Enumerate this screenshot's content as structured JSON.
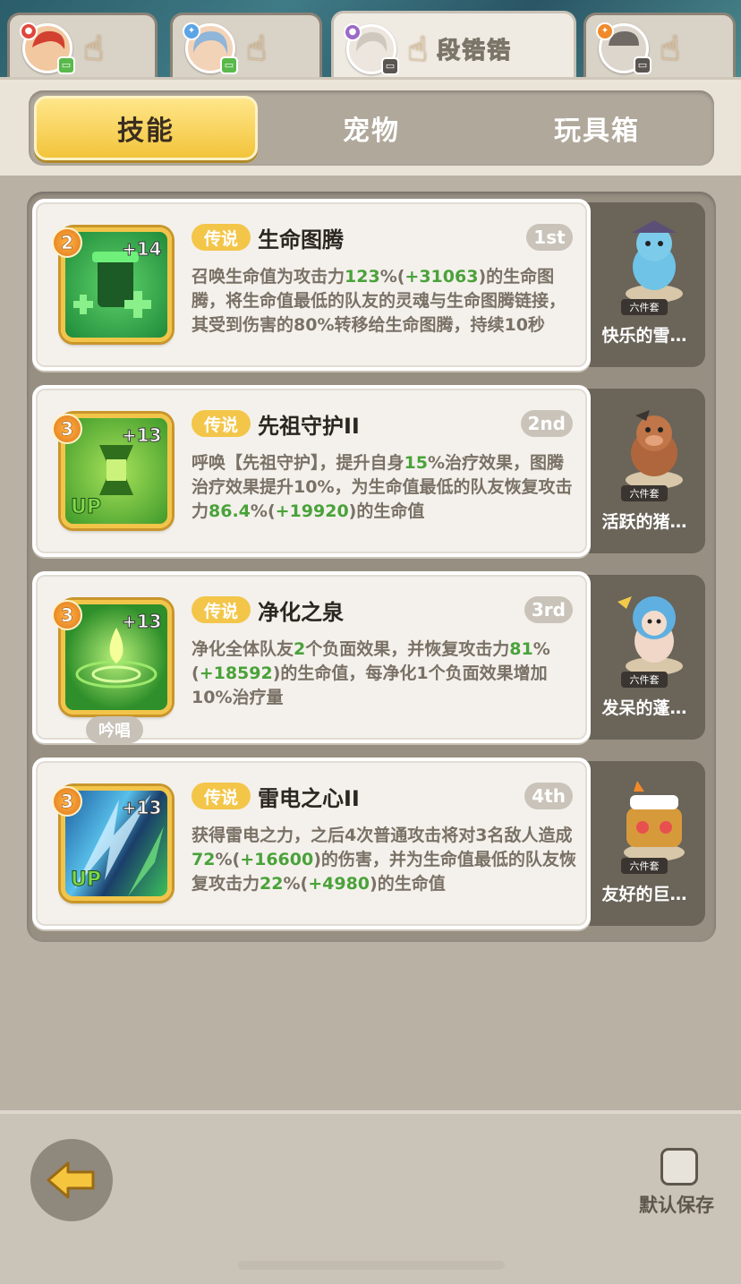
{
  "hero_tabs": [
    {
      "name": "",
      "badge_color": "#59b94a",
      "elem_color": "#e0473c",
      "hair_color": "#d2402f",
      "skin": "#f2c8a0"
    },
    {
      "name": "",
      "badge_color": "#59b94a",
      "elem_color": "#5ba4e6",
      "hair_color": "#8fb5d8",
      "skin": "#f3d3b8"
    },
    {
      "name": "段锆锆",
      "badge_color": "#5a5550",
      "elem_color": "#9b6ac6",
      "hair_color": "#d9d4cd",
      "skin": "#ece6de"
    },
    {
      "name": "",
      "badge_color": "#5a5550",
      "elem_color": "#f08a2a",
      "hair_color": "#6f6a63",
      "skin": "#ddd6cc"
    }
  ],
  "category_tabs": [
    {
      "label": "技能",
      "active": true
    },
    {
      "label": "宠物",
      "active": false
    },
    {
      "label": "玩具箱",
      "active": false
    }
  ],
  "skills": [
    {
      "level": "2",
      "plus": "+14",
      "rarity": "传说",
      "name": "生命图腾",
      "rank": "1st",
      "up": "",
      "chant": "",
      "icon_bg": "#1f8a3a",
      "icon_glyph": "✚",
      "desc": [
        {
          "t": "召唤生命值为攻击力"
        },
        {
          "t": "123",
          "g": true
        },
        {
          "t": "%("
        },
        {
          "t": "+31063",
          "g": true
        },
        {
          "t": ")的生命图腾，将生命值最低的队友的灵魂与生命图腾链接，其受到伤害的80%转移给生命图腾，持续10秒"
        }
      ],
      "pet": {
        "set": "六件套",
        "name": "快乐的雪…",
        "color": "#6ec3e6"
      }
    },
    {
      "level": "3",
      "plus": "+13",
      "rarity": "传说",
      "name": "先祖守护II",
      "rank": "2nd",
      "up": "UP",
      "chant": "",
      "icon_bg": "#3f9a2a",
      "icon_glyph": "⧗",
      "desc": [
        {
          "t": "呼唤【先祖守护】，提升自身"
        },
        {
          "t": "15",
          "g": true
        },
        {
          "t": "%治疗效果，图腾治疗效果提升10%，为生命值最低的队友恢复攻击力"
        },
        {
          "t": "86.4",
          "g": true
        },
        {
          "t": "%("
        },
        {
          "t": "+19920",
          "g": true
        },
        {
          "t": ")的生命值"
        }
      ],
      "pet": {
        "set": "六件套",
        "name": "活跃的猪…",
        "color": "#b0663c"
      }
    },
    {
      "level": "3",
      "plus": "+13",
      "rarity": "传说",
      "name": "净化之泉",
      "rank": "3rd",
      "up": "",
      "chant": "吟唱",
      "icon_bg": "#2f8f2a",
      "icon_glyph": "💧",
      "desc": [
        {
          "t": "净化全体队友"
        },
        {
          "t": "2",
          "g": true
        },
        {
          "t": "个负面效果，并恢复攻击力"
        },
        {
          "t": "81",
          "g": true
        },
        {
          "t": "%("
        },
        {
          "t": "+18592",
          "g": true
        },
        {
          "t": ")的生命值，每净化1个负面效果增加10%治疗量"
        }
      ],
      "pet": {
        "set": "六件套",
        "name": "发呆的蓬…",
        "color": "#5fb0e0"
      }
    },
    {
      "level": "3",
      "plus": "+13",
      "rarity": "传说",
      "name": "雷电之心II",
      "rank": "4th",
      "up": "UP",
      "chant": "",
      "icon_bg": "#1d5fa0",
      "icon_glyph": "⚡",
      "desc": [
        {
          "t": "获得雷电之力，之后4次普通攻击将对3名敌人造成"
        },
        {
          "t": "72",
          "g": true
        },
        {
          "t": "%("
        },
        {
          "t": "+16600",
          "g": true
        },
        {
          "t": ")的伤害，并为生命值最低的队友恢复攻击力"
        },
        {
          "t": "22",
          "g": true
        },
        {
          "t": "%("
        },
        {
          "t": "+4980",
          "g": true
        },
        {
          "t": ")的生命值"
        }
      ],
      "pet": {
        "set": "六件套",
        "name": "友好的巨…",
        "color": "#d79a3a"
      }
    }
  ],
  "footer": {
    "save_label": "默认保存"
  }
}
